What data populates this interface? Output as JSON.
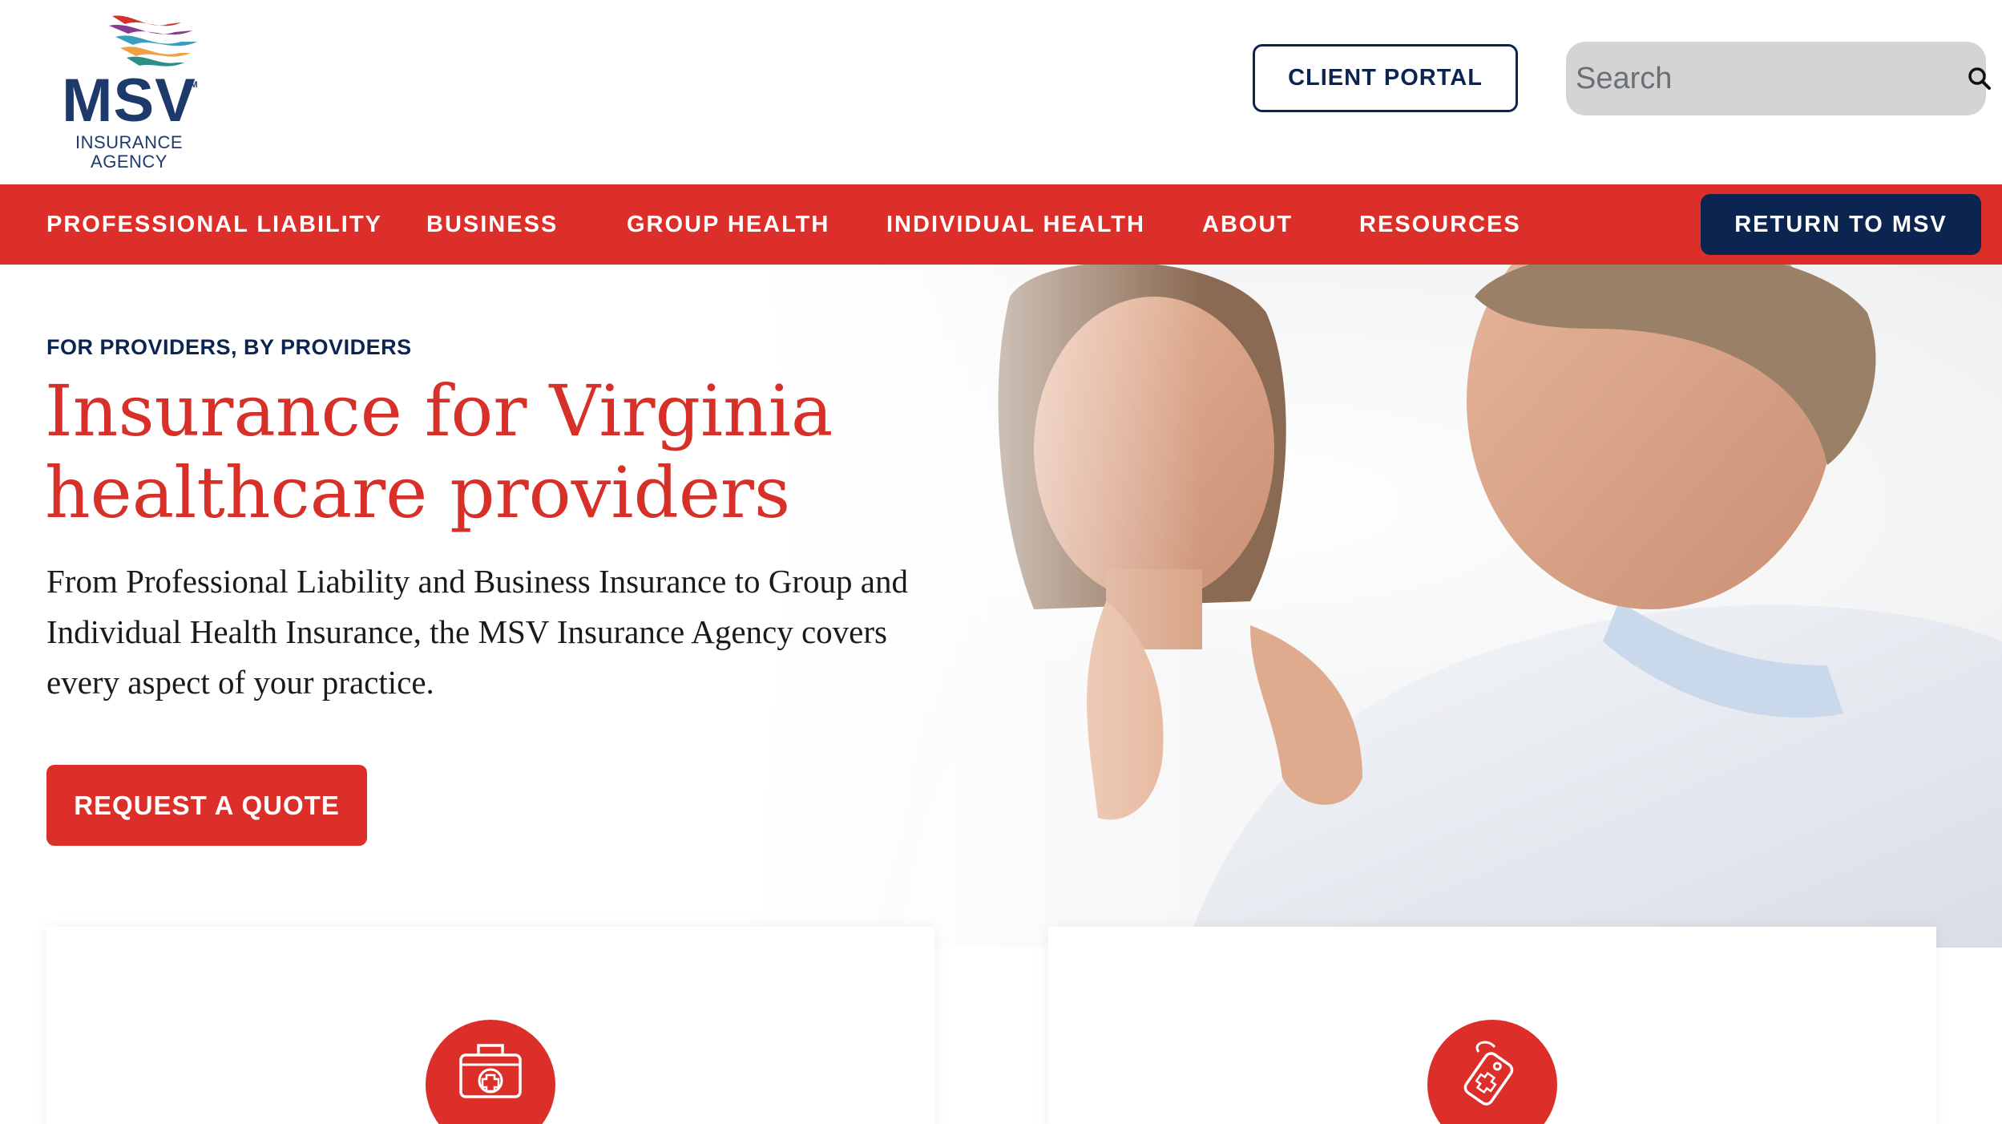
{
  "logo": {
    "name": "MSV",
    "sm_mark": "SM",
    "subtitle_line1": "INSURANCE",
    "subtitle_line2": "AGENCY"
  },
  "header": {
    "client_portal_label": "CLIENT PORTAL",
    "search_placeholder": "Search",
    "search_icon": "search-icon"
  },
  "nav": {
    "items": [
      {
        "label": "PROFESSIONAL LIABILITY"
      },
      {
        "label": "BUSINESS"
      },
      {
        "label": "GROUP HEALTH"
      },
      {
        "label": "INDIVIDUAL HEALTH"
      },
      {
        "label": "ABOUT"
      },
      {
        "label": "RESOURCES"
      }
    ],
    "return_label": "RETURN TO MSV"
  },
  "hero": {
    "eyebrow": "FOR PROVIDERS, BY PROVIDERS",
    "title_line1": "Insurance for Virginia",
    "title_line2": "healthcare providers",
    "body": "From Professional Liability and Business Insurance to Group and Individual Health Insurance, the MSV Insurance Agency covers every aspect of your practice.",
    "cta_label": "REQUEST A QUOTE",
    "image": "doctor-examining-child-photo"
  },
  "cards": [
    {
      "icon": "medical-kit-icon"
    },
    {
      "icon": "medical-tag-icon"
    }
  ],
  "colors": {
    "brand_red": "#dc2f2a",
    "brand_navy": "#0b2450",
    "logo_navy": "#1d3a6b",
    "search_bg": "#d4d4d4"
  }
}
